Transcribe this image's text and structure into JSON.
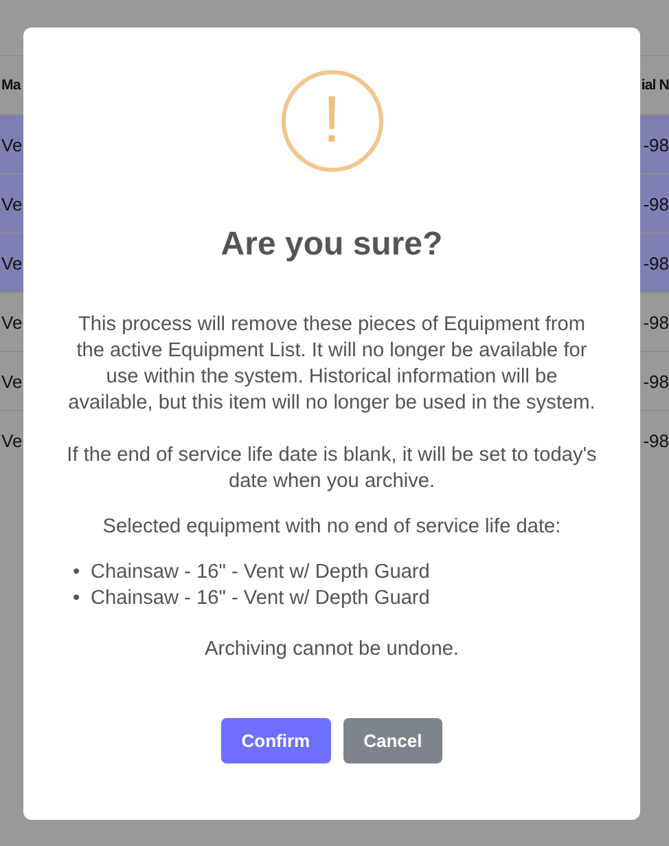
{
  "background_table": {
    "columns": [
      "Ma",
      "ial N"
    ],
    "rows": [
      {
        "cells": [
          "Ve",
          "-98"
        ],
        "selected": true
      },
      {
        "cells": [
          "Ve",
          "-98"
        ],
        "selected": true
      },
      {
        "cells": [
          "Ve",
          "-98"
        ],
        "selected": true
      },
      {
        "cells": [
          "Ve",
          "-98"
        ],
        "selected": false
      },
      {
        "cells": [
          "Ve",
          "-98"
        ],
        "selected": false
      },
      {
        "cells": [
          "Ve",
          "-98"
        ],
        "selected": false
      }
    ]
  },
  "dialog": {
    "icon": "!",
    "title": "Are you sure?",
    "paragraphs": [
      "This process will remove these pieces of Equipment from the active Equipment List. It will no longer be available for use within the system. Historical information will be available, but this item will no longer be used in the system.",
      "If the end of service life date is blank, it will be set to today's date when you archive.",
      "Selected equipment with no end of service life date:"
    ],
    "items": [
      {
        "marker": "•",
        "text": "Chainsaw - 16\" - Vent w/ Depth Guard"
      },
      {
        "marker": "•",
        "text": "Chainsaw - 16\" - Vent w/ Depth Guard"
      }
    ],
    "note": "Archiving cannot be undone.",
    "buttons": [
      {
        "label": "Confirm",
        "kind": "primary"
      },
      {
        "label": "Cancel",
        "kind": "secondary"
      }
    ]
  }
}
